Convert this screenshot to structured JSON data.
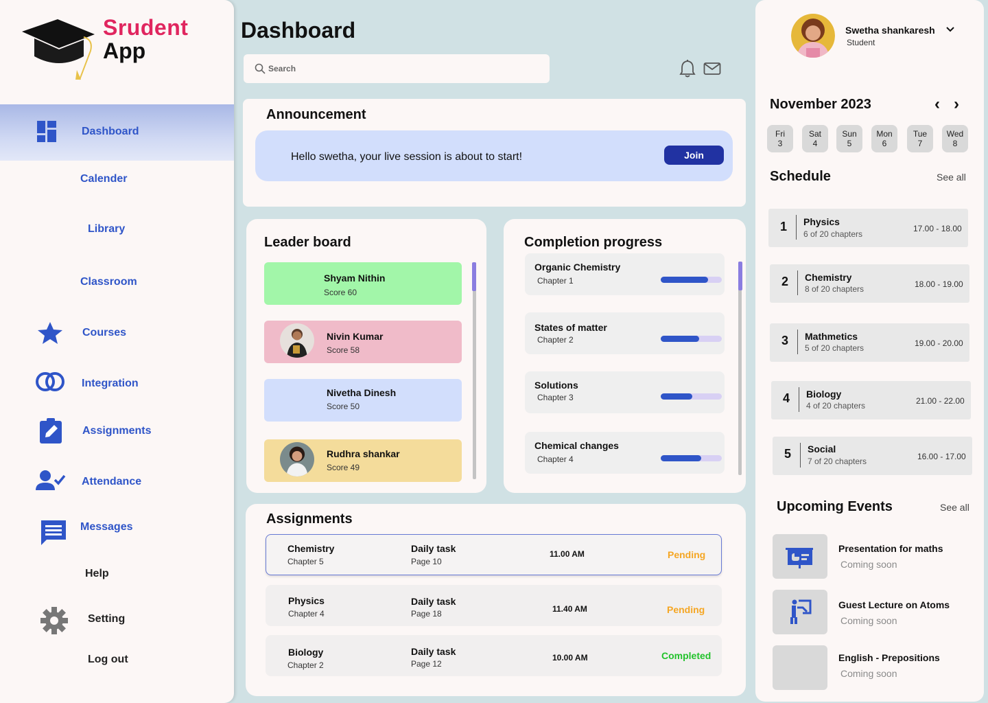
{
  "brand": {
    "line1": "Srudent",
    "line2": "App"
  },
  "nav": {
    "dashboard": "Dashboard",
    "calender": "Calender",
    "library": "Library",
    "classroom": "Classroom",
    "courses": "Courses",
    "integration": "Integration",
    "assignments": "Assignments",
    "attendance": "Attendance",
    "messages": "Messages",
    "help": "Help",
    "setting": "Setting",
    "logout": "Log out"
  },
  "header": {
    "title": "Dashboard",
    "search_placeholder": "Search"
  },
  "announcement": {
    "title": "Announcement",
    "message": "Hello swetha, your live session is about to start!",
    "join_label": "Join"
  },
  "leaderboard": {
    "title": "Leader board",
    "items": [
      {
        "name": "Shyam Nithin",
        "score": "Score 60",
        "color": "#a2f6a9"
      },
      {
        "name": "Nivin Kumar",
        "score": "Score 58",
        "color": "#f0bbc9"
      },
      {
        "name": "Nivetha Dinesh",
        "score": "Score 50",
        "color": "#d2defc"
      },
      {
        "name": "Rudhra shankar",
        "score": "Score 49",
        "color": "#f4dc9b"
      }
    ]
  },
  "completion": {
    "title": "Completion progress",
    "items": [
      {
        "name": "Organic Chemistry",
        "chapter": "Chapter 1",
        "progress": 0.78
      },
      {
        "name": "States of matter",
        "chapter": "Chapter 2",
        "progress": 0.63
      },
      {
        "name": "Solutions",
        "chapter": "Chapter 3",
        "progress": 0.52
      },
      {
        "name": "Chemical changes",
        "chapter": "Chapter 4",
        "progress": 0.66
      }
    ]
  },
  "assignments": {
    "title": "Assignments",
    "rows": [
      {
        "subject": "Chemistry",
        "chapter": "Chapter 5",
        "task": "Daily task",
        "page": "Page 10",
        "time": "11.00 AM",
        "status": "Pending"
      },
      {
        "subject": "Physics",
        "chapter": "Chapter 4",
        "task": "Daily task",
        "page": "Page 18",
        "time": "11.40 AM",
        "status": "Pending"
      },
      {
        "subject": "Biology",
        "chapter": "Chapter 2",
        "task": "Daily task",
        "page": "Page 12",
        "time": "10.00 AM",
        "status": "Completed"
      }
    ]
  },
  "colors": {
    "accent": "#2f55c8",
    "brand": "#e0265f",
    "pending": "#f5a623",
    "completed": "#22c22b",
    "join": "#2132a2"
  },
  "profile": {
    "name": "Swetha shankaresh",
    "role": "Student"
  },
  "calendar": {
    "month": "November 2023",
    "prev": "‹",
    "next": "›",
    "days": [
      {
        "dow": "Fri",
        "num": "3"
      },
      {
        "dow": "Sat",
        "num": "4"
      },
      {
        "dow": "Sun",
        "num": "5"
      },
      {
        "dow": "Mon",
        "num": "6"
      },
      {
        "dow": "Tue",
        "num": "7"
      },
      {
        "dow": "Wed",
        "num": "8"
      }
    ]
  },
  "schedule": {
    "title": "Schedule",
    "see_all": "See all",
    "items": [
      {
        "num": "1",
        "subject": "Physics",
        "chapters": "6 of 20 chapters",
        "time": "17.00 - 18.00"
      },
      {
        "num": "2",
        "subject": "Chemistry",
        "chapters": "8 of 20 chapters",
        "time": "18.00 - 19.00"
      },
      {
        "num": "3",
        "subject": "Mathmetics",
        "chapters": "5 of 20 chapters",
        "time": "19.00 - 20.00"
      },
      {
        "num": "4",
        "subject": "Biology",
        "chapters": "4 of 20 chapters",
        "time": "21.00 - 22.00"
      },
      {
        "num": "5",
        "subject": "Social",
        "chapters": "7 of 20 chapters",
        "time": "16.00 - 17.00"
      }
    ]
  },
  "events": {
    "title": "Upcoming Events",
    "see_all": "See all",
    "items": [
      {
        "title": "Presentation for maths",
        "sub": "Coming soon",
        "icon": "presentation-icon"
      },
      {
        "title": "Guest Lecture on Atoms",
        "sub": "Coming soon",
        "icon": "lecture-icon"
      },
      {
        "title": "English - Prepositions",
        "sub": "Coming soon",
        "icon": ""
      }
    ]
  }
}
